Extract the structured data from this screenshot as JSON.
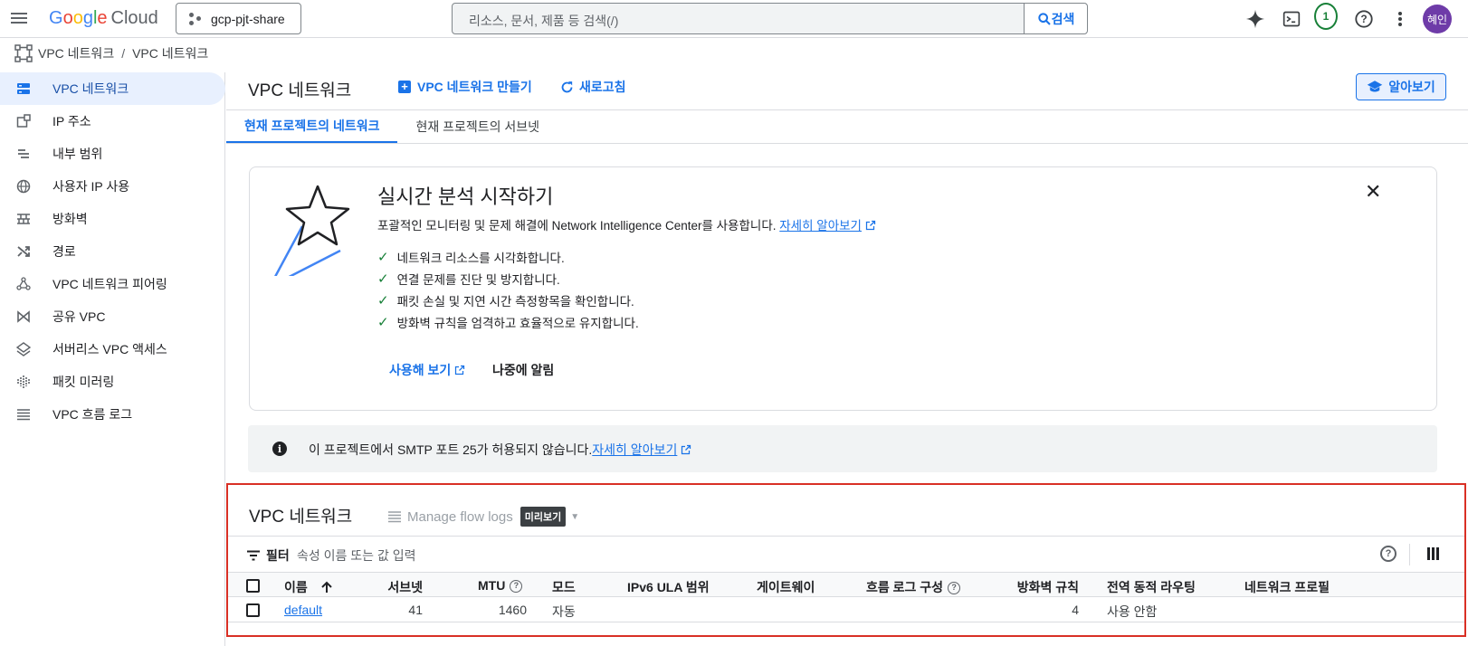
{
  "topbar": {
    "logo": {
      "g": "G",
      "o1": "o",
      "o2": "o",
      "g2": "g",
      "l": "l",
      "e": "e",
      "cloud": "Cloud"
    },
    "project": "gcp-pjt-share",
    "search_placeholder": "리소스, 문서, 제품 등 검색(/)",
    "search_button": "검색",
    "notification_count": "1",
    "avatar_text": "혜인"
  },
  "breadcrumb": {
    "first": "VPC 네트워크",
    "separator": "/",
    "second": "VPC 네트워크"
  },
  "sidebar": {
    "items": [
      {
        "label": "VPC 네트워크"
      },
      {
        "label": "IP 주소"
      },
      {
        "label": "내부 범위"
      },
      {
        "label": "사용자 IP 사용"
      },
      {
        "label": "방화벽"
      },
      {
        "label": "경로"
      },
      {
        "label": "VPC 네트워크 피어링"
      },
      {
        "label": "공유 VPC"
      },
      {
        "label": "서버리스 VPC 액세스"
      },
      {
        "label": "패킷 미러링"
      },
      {
        "label": "VPC 흐름 로그"
      }
    ]
  },
  "main": {
    "title": "VPC 네트워크",
    "create_button": "VPC 네트워크 만들기",
    "refresh_button": "새로고침",
    "learn_button": "알아보기",
    "tabs": [
      {
        "label": "현재 프로젝트의 네트워크"
      },
      {
        "label": "현재 프로젝트의 서브넷"
      }
    ]
  },
  "promo": {
    "title": "실시간 분석 시작하기",
    "desc": "포괄적인 모니터링 및 문제 해결에 Network Intelligence Center를 사용합니다.",
    "desc_link": "자세히 알아보기",
    "checks": [
      "네트워크 리소스를 시각화합니다.",
      "연결 문제를 진단 및 방지합니다.",
      "패킷 손실 및 지연 시간 측정항목을 확인합니다.",
      "방화벽 규칙을 엄격하고 효율적으로 유지합니다."
    ],
    "try_button": "사용해 보기",
    "later_button": "나중에 알림"
  },
  "info": {
    "text": "이 프로젝트에서 SMTP 포트 25가 허용되지 않습니다.",
    "link": "자세히 알아보기"
  },
  "table": {
    "title": "VPC 네트워크",
    "flow_logs": "Manage flow logs",
    "preview_badge": "미리보기",
    "filter_label": "필터",
    "filter_placeholder": "속성 이름 또는 값 입력",
    "columns": {
      "name": "이름",
      "subnets": "서브넷",
      "mtu": "MTU",
      "mode": "모드",
      "ipv6": "IPv6 ULA 범위",
      "gateway": "게이트웨이",
      "flow_config": "흐름 로그 구성",
      "firewall": "방화벽 규칙",
      "routing": "전역 동적 라우팅",
      "profile": "네트워크 프로필"
    },
    "rows": [
      {
        "name": "default",
        "subnets": "41",
        "mtu": "1460",
        "mode": "자동",
        "ipv6": "",
        "gateway": "",
        "flow_config": "",
        "firewall": "4",
        "routing": "사용 안함",
        "profile": ""
      }
    ]
  },
  "colors": {
    "accent": "#1a73e8",
    "highlight_border": "#d93025",
    "active_bg": "#e8f0fe",
    "check": "#188038",
    "avatar": "#6e3ba8"
  }
}
